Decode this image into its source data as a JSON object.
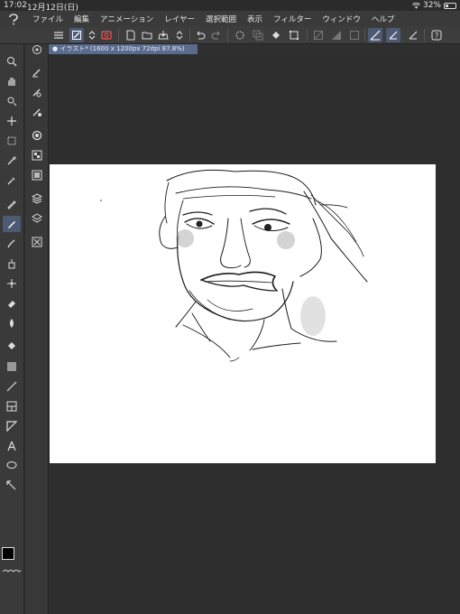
{
  "status": {
    "time": "17:02",
    "date": "12月12日(日)",
    "battery": "32%"
  },
  "menu": {
    "items": [
      "ファイル",
      "編集",
      "アニメーション",
      "レイヤー",
      "選択範囲",
      "表示",
      "フィルター",
      "ウィンドウ",
      "ヘルプ"
    ]
  },
  "document": {
    "tab_label": "● イラスト* (1600 x 1200px 72dpi 87.8%)"
  },
  "colors": {
    "accent": "#5b6b8e",
    "active_tool": "#4e5a74",
    "foreground": "#000000",
    "background": "#ffffff"
  },
  "tools": {
    "primary": [
      "navigator-icon",
      "zoom-icon",
      "hand-icon",
      "rotate-icon",
      "move-icon",
      "selection-icon",
      "magic-wand-icon",
      "eyedropper-icon",
      "pen-icon",
      "pencil-icon",
      "brush-icon",
      "airbrush-icon",
      "decoration-icon",
      "eraser-icon",
      "blend-icon",
      "fill-icon",
      "gradient-icon",
      "figure-icon",
      "frame-icon",
      "ruler-icon",
      "text-icon",
      "balloon-icon",
      "correction-line-icon"
    ],
    "secondary": [
      "zoom-icon",
      "layer-property-icon",
      "layer-search-icon",
      "layer-color-icon",
      "color-wheel-icon",
      "color-set-icon",
      "intermediate-color-icon",
      "material-icon",
      "layer-stack-icon",
      "navigator-panel-icon"
    ]
  }
}
